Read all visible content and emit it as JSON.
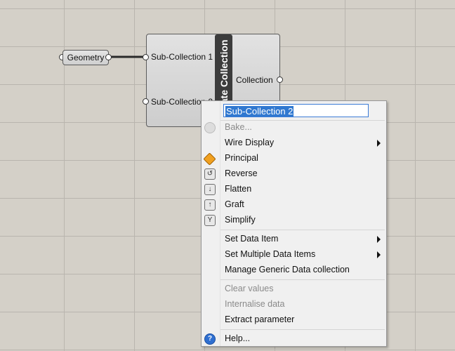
{
  "canvas": {
    "geometry_param": {
      "label": "Geometry"
    },
    "component": {
      "title": "Create Collection",
      "inputs": [
        "Sub-Collection 1",
        "Sub-Collection 2"
      ],
      "output": "Collection"
    }
  },
  "context_menu": {
    "rename_value": "Sub-Collection 2",
    "items": [
      {
        "label": "Bake...",
        "icon": "bake-icon",
        "disabled": true
      },
      {
        "label": "Wire Display",
        "submenu": true
      },
      {
        "label": "Principal",
        "icon": "principal-icon"
      },
      {
        "label": "Reverse",
        "icon": "reverse-icon"
      },
      {
        "label": "Flatten",
        "icon": "flatten-icon"
      },
      {
        "label": "Graft",
        "icon": "graft-icon"
      },
      {
        "label": "Simplify",
        "icon": "simplify-icon"
      },
      {
        "label": "Set Data Item",
        "submenu": true
      },
      {
        "label": "Set Multiple Data Items",
        "submenu": true
      },
      {
        "label": "Manage Generic Data collection"
      },
      {
        "label": "Clear values",
        "disabled": true
      },
      {
        "label": "Internalise data",
        "disabled": true
      },
      {
        "label": "Extract parameter"
      },
      {
        "label": "Help...",
        "icon": "help-icon"
      }
    ]
  },
  "colors": {
    "canvas": "#d4d0c8",
    "selection": "#3078d0",
    "component_bar": "#3c3c3c"
  }
}
